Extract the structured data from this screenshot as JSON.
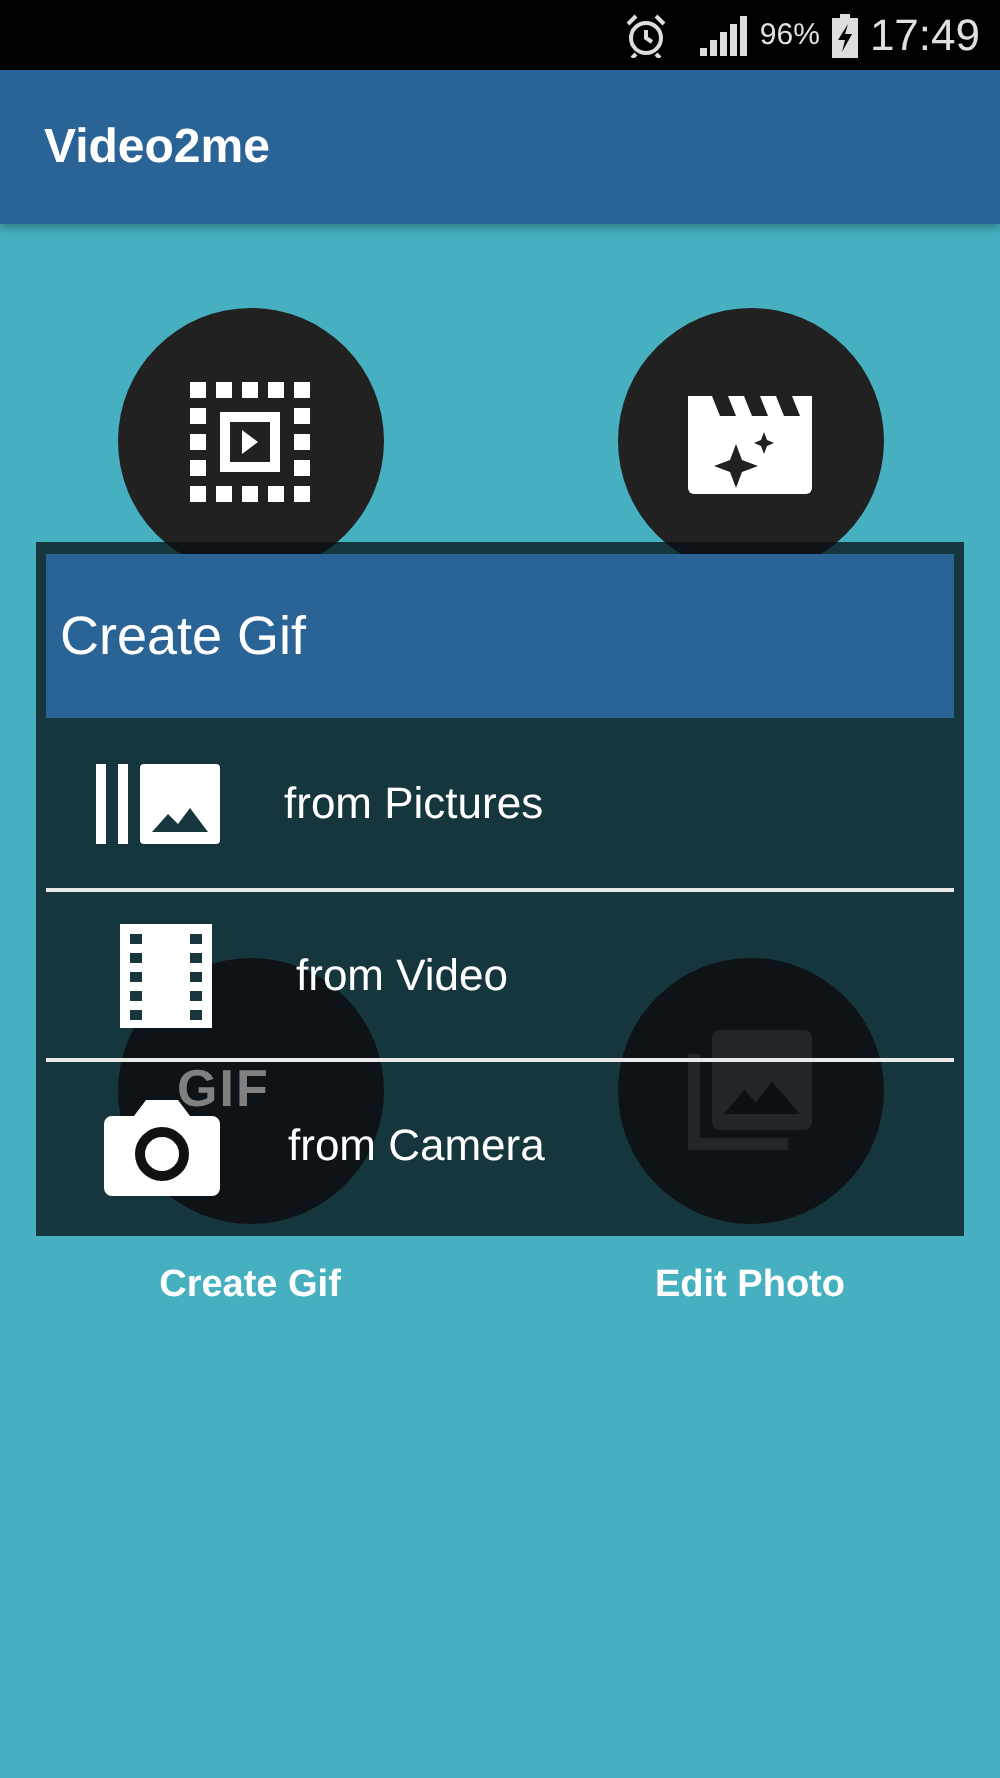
{
  "status_bar": {
    "battery": "96%",
    "time": "17:49"
  },
  "app_bar": {
    "title": "Video2me"
  },
  "tiles": [
    {
      "kind": "video-frame"
    },
    {
      "kind": "clapper"
    },
    {
      "kind": "gif",
      "badge": "GIF",
      "label": "Create Gif"
    },
    {
      "kind": "photos",
      "label": "Edit Photo"
    }
  ],
  "dialog": {
    "title": "Create Gif",
    "options": [
      {
        "kind": "pictures",
        "label": "from Pictures"
      },
      {
        "kind": "video",
        "label": "from Video"
      },
      {
        "kind": "camera",
        "label": "from Camera"
      }
    ]
  }
}
